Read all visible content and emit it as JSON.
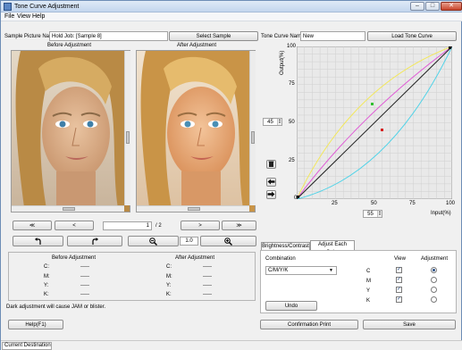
{
  "window": {
    "title": "Tone Curve Adjustment",
    "minimize_glyph": "–",
    "maximize_glyph": "□",
    "close_glyph": "✕"
  },
  "menu": {
    "file": "File",
    "view": "View",
    "help": "Help"
  },
  "sample": {
    "label": "Sample Picture Name",
    "value": "Hold Job: [Sample 8]",
    "select_button": "Select Sample"
  },
  "tone_curve": {
    "label": "Tone Curve Name",
    "value": "New",
    "load_button": "Load Tone Curve"
  },
  "preview": {
    "before_label": "Before Adjustment",
    "after_label": "After Adjustment"
  },
  "nav": {
    "first": "≪",
    "prev": "<",
    "next": ">",
    "last": "≫",
    "page_current": "1",
    "page_sep": "/ 2",
    "zoom_value": "1.0"
  },
  "table": {
    "before_header": "Before Adjustment",
    "after_header": "After Adjustment",
    "rows": [
      {
        "label": "C:",
        "before": "-----",
        "after_label": "C:",
        "after": "-----"
      },
      {
        "label": "M:",
        "before": "-----",
        "after_label": "M:",
        "after": "-----"
      },
      {
        "label": "Y:",
        "before": "-----",
        "after_label": "Y:",
        "after": "-----"
      },
      {
        "label": "K:",
        "before": "-----",
        "after_label": "K:",
        "after": "-----"
      }
    ]
  },
  "warning": "Dark adjustment will cause JAM or blister.",
  "help_button": "Help(F1)",
  "graph": {
    "y_axis_label": "Output(%)",
    "x_axis_label": "Input(%)",
    "y_ticks": [
      "100",
      "75",
      "50",
      "25",
      "0"
    ],
    "x_ticks": [
      "0",
      "25",
      "50",
      "75",
      "100"
    ],
    "output_spin": "45",
    "input_spin": "55",
    "colors": {
      "cyan": "#4fd3e8",
      "magenta": "#e05bd6",
      "yellow": "#f3e858",
      "black": "#222222",
      "grid": "#cfcfcf",
      "bg": "#e9e9e9"
    }
  },
  "tabs": {
    "brightness": "Brightness/Contrast",
    "each_color": "Adjust Each Color"
  },
  "combination": {
    "label": "Combination",
    "selected": "C/M/Y/K",
    "view_header": "View",
    "adjust_header": "Adjustment",
    "channels": [
      "C",
      "M",
      "Y",
      "K"
    ],
    "undo_button": "Undo"
  },
  "confirm_button": "Confirmation Print",
  "save_button": "Save",
  "status": {
    "destination": "Current Destination"
  }
}
